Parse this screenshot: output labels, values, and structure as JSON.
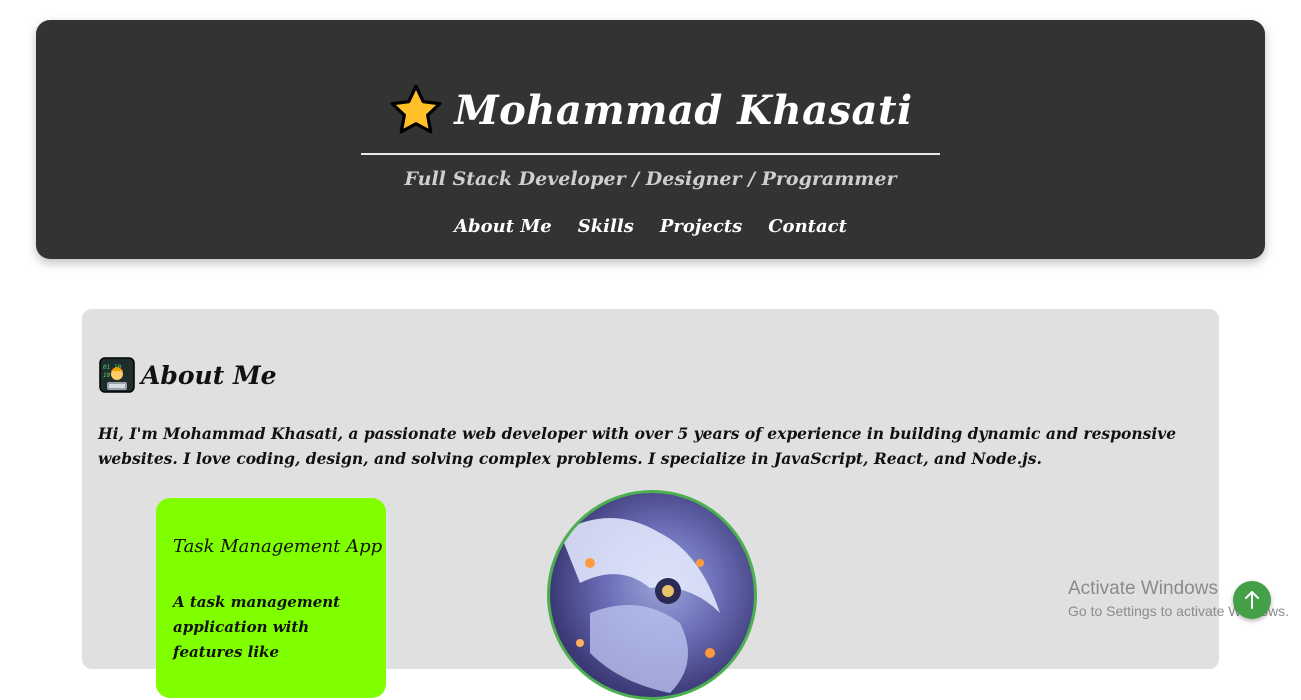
{
  "header": {
    "title": "Mohammad Khasati",
    "subtitle": "Full Stack Developer / Designer / Programmer",
    "nav": [
      "About Me",
      "Skills",
      "Projects",
      "Contact"
    ]
  },
  "about": {
    "title": "About Me",
    "text": "Hi, I'm Mohammad Khasati, a passionate web developer with over 5 years of experience in building dynamic and responsive websites. I love coding, design, and solving complex problems. I specialize in JavaScript, React, and Node.js."
  },
  "project_card": {
    "title": "Task Management App",
    "description": "A task management application with features like"
  },
  "watermark": {
    "title": "Activate Windows",
    "subtitle": "Go to Settings to activate Windows."
  },
  "back_to_top": {
    "icon": "arrow-up-icon",
    "glyph": "↑"
  },
  "colors": {
    "header_bg": "#333333",
    "section_bg": "#e0e0e0",
    "card_bg": "#7fff00",
    "accent_green": "#43a047"
  }
}
